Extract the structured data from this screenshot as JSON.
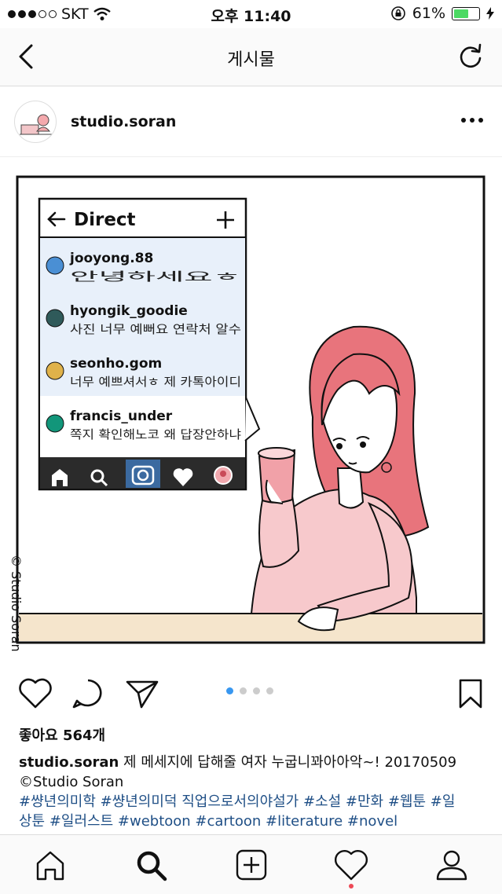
{
  "status_bar": {
    "carrier": "SKT",
    "time": "오후 11:40",
    "battery": "61%",
    "battery_level": 0.61
  },
  "nav": {
    "title": "게시물",
    "back_icon": "chevron-left-icon",
    "refresh_icon": "refresh-icon"
  },
  "post": {
    "username": "studio.soran",
    "image": {
      "watermark": "© Studio Soran",
      "dm_panel": {
        "title": "Direct",
        "messages": [
          {
            "user": "jooyong.88",
            "text": "안녕하세요ㅎ",
            "color": "#4a8fd4"
          },
          {
            "user": "hyongik_goodie",
            "text": "사진 너무 예뻐요 연락처 알수",
            "color": "#2f5a5a"
          },
          {
            "user": "seonho.gom",
            "text": "너무 예쁘셔서ㅎ 제 카톡아이디",
            "color": "#e0b24a"
          },
          {
            "user": "francis_under",
            "text": "쪽지 확인해노코 왜 답장안하냐",
            "color": "#12967a"
          }
        ]
      }
    },
    "likes": "좋아요 564개",
    "caption": {
      "username": "studio.soran",
      "text": " 제 메세지에 답해줄 여자 누굽니꽈아아악~! 20170509",
      "credit": "©Studio Soran",
      "hashtags_line1": "#썅년의미학 #썅년의미덕 직업으로서의야설가 #소설 #만화 #웹툰 #일",
      "hashtags_line2": "상툰 #일러스트 #webtoon #cartoon #literature #novel"
    },
    "pager": {
      "count": 4,
      "active": 0
    }
  },
  "tabbar": {
    "items": [
      "home-icon",
      "search-icon",
      "add-icon",
      "heart-icon",
      "profile-icon"
    ]
  },
  "colors": {
    "accent": "#3897f0",
    "hashtag": "#1f4f86",
    "battery": "#4cd964",
    "hair": "#e8747c",
    "skin": "#f7c9cc"
  }
}
